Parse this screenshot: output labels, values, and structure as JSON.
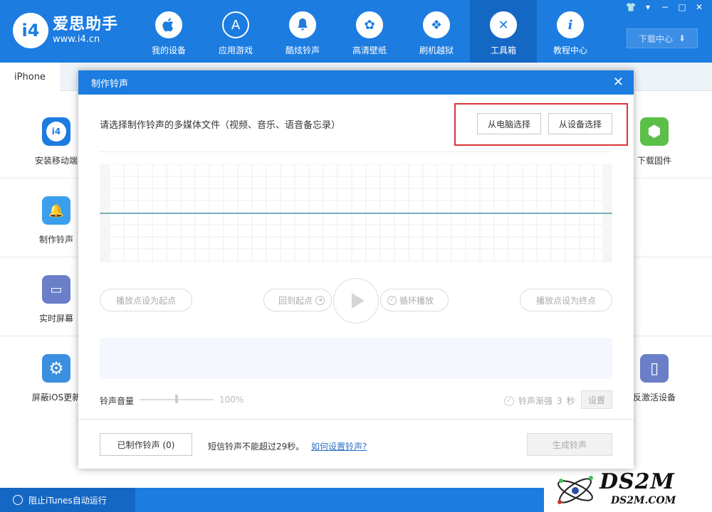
{
  "app": {
    "name": "爱思助手",
    "url": "www.i4.cn",
    "badge": "i4"
  },
  "nav": [
    {
      "label": "我的设备",
      "icon": "apple-icon",
      "glyph": ""
    },
    {
      "label": "应用游戏",
      "icon": "app-store-icon",
      "glyph": "A"
    },
    {
      "label": "酷炫铃声",
      "icon": "bell-icon",
      "glyph": "🔔"
    },
    {
      "label": "高清壁纸",
      "icon": "flower-icon",
      "glyph": "✿"
    },
    {
      "label": "刷机越狱",
      "icon": "dropbox-icon",
      "glyph": "❖"
    },
    {
      "label": "工具箱",
      "icon": "tools-icon",
      "glyph": "✕"
    },
    {
      "label": "教程中心",
      "icon": "info-icon",
      "glyph": "i"
    }
  ],
  "window_controls": [
    "👕",
    "▾",
    "−",
    "□",
    "✕"
  ],
  "download_center": {
    "label": "下载中心",
    "icon": "download-icon",
    "glyph": "⬇"
  },
  "tabs": {
    "device": "iPhone"
  },
  "tools_left": [
    {
      "label": "安装移动端",
      "icon": "i4-app-icon",
      "color": "#1c7ce0",
      "glyph": "i4"
    },
    {
      "label": "制作铃声",
      "icon": "bell-plus-icon",
      "color": "#3aa0ee",
      "glyph": "🔔"
    },
    {
      "label": "实时屏幕",
      "icon": "monitor-icon",
      "color": "#6a7fc8",
      "glyph": "▭"
    },
    {
      "label": "屏蔽iOS更新",
      "icon": "gear-block-icon",
      "color": "#3a8fe0",
      "glyph": "⚙"
    }
  ],
  "tools_right": [
    {
      "label": "下载固件",
      "icon": "cube-icon",
      "color": "#5cbf4a",
      "glyph": "⬢"
    },
    {
      "label": "反激活设备",
      "icon": "device-icon",
      "color": "#6a7fc8",
      "glyph": "▯"
    }
  ],
  "status": {
    "itunes_block": "阻止iTunes自动运行"
  },
  "watermark": {
    "big": "DS2M",
    "small": "DS2M.COM"
  },
  "dialog": {
    "title": "制作铃声",
    "close_glyph": "✕",
    "prompt": "请选择制作铃声的多媒体文件（视频、音乐、语音备忘录）",
    "from_pc": "从电脑选择",
    "from_device": "从设备选择",
    "set_start": "播放点设为起点",
    "back_to_start": "回到起点",
    "loop_play": "循环播放",
    "set_end": "播放点设为终点",
    "volume_label": "铃声音量",
    "volume_pct": "100%",
    "volume_value": 0.5,
    "fade_label": "铃声渐强",
    "fade_seconds": "3",
    "fade_unit": "秒",
    "settings": "设置",
    "made_ringtones": "已制作铃声 (0)",
    "sms_note": "短信铃声不能超过29秒。",
    "how_to": "如何设置铃声?",
    "generate": "生成铃声"
  }
}
